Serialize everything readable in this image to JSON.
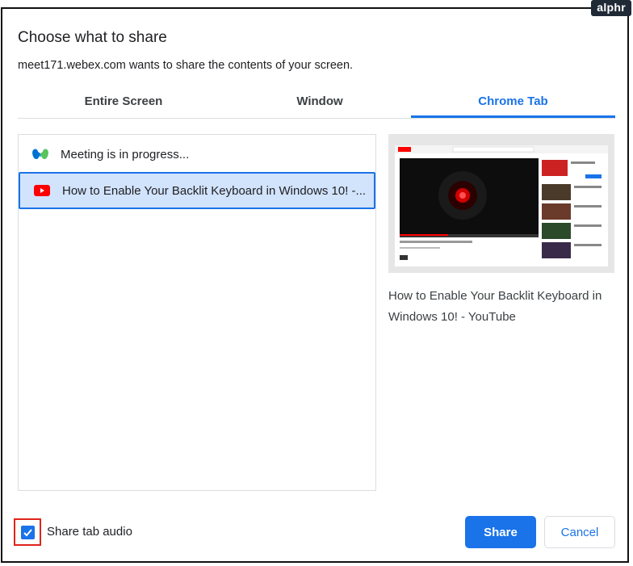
{
  "watermark": "alphr",
  "dialog": {
    "title": "Choose what to share",
    "subtitle": "meet171.webex.com wants to share the contents of your screen."
  },
  "tabs": [
    {
      "label": "Entire Screen",
      "active": false
    },
    {
      "label": "Window",
      "active": false
    },
    {
      "label": "Chrome Tab",
      "active": true
    }
  ],
  "list": [
    {
      "label": "Meeting is in progress...",
      "icon": "webex-icon",
      "selected": false
    },
    {
      "label": "How to Enable Your Backlit Keyboard in Windows 10! -...",
      "icon": "youtube-icon",
      "selected": true
    }
  ],
  "preview": {
    "title": "How to Enable Your Backlit Keyboard in Windows 10! - YouTube"
  },
  "footer": {
    "share_audio_label": "Share tab audio",
    "share_audio_checked": true,
    "share_label": "Share",
    "cancel_label": "Cancel"
  },
  "colors": {
    "accent": "#1a73e8",
    "selected_bg": "#d2e3fc",
    "highlight_box": "#e0241b",
    "youtube_red": "#ff0000"
  }
}
